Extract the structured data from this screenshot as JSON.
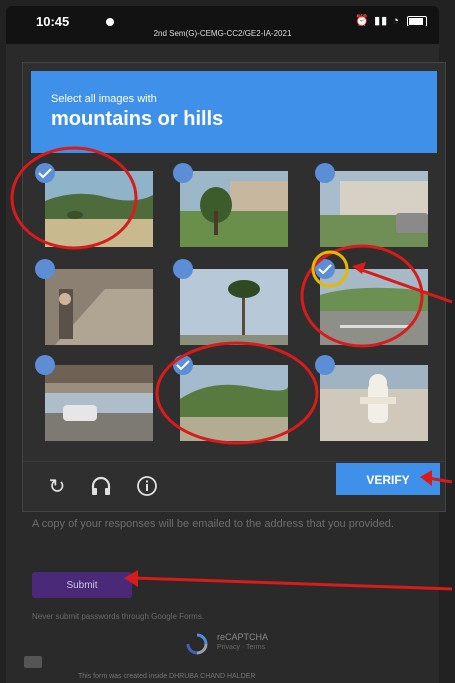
{
  "status_bar": {
    "time": "10:45",
    "battery_label": ""
  },
  "url_bar": {
    "text": "2nd Sem(G)-CEMG-CC2/GE2-IA-2021"
  },
  "captcha": {
    "instruction_line1": "Select all images with",
    "instruction_line2": "mountains or hills",
    "tiles": [
      {
        "id": "tile-1",
        "selected": true
      },
      {
        "id": "tile-2",
        "selected": false
      },
      {
        "id": "tile-3",
        "selected": false
      },
      {
        "id": "tile-4",
        "selected": false
      },
      {
        "id": "tile-5",
        "selected": false
      },
      {
        "id": "tile-6",
        "selected": true
      },
      {
        "id": "tile-7",
        "selected": false
      },
      {
        "id": "tile-8",
        "selected": true
      },
      {
        "id": "tile-9",
        "selected": false
      }
    ],
    "verify_label": "VERIFY",
    "icons": [
      "reload-icon",
      "headphones-icon",
      "info-icon"
    ]
  },
  "form": {
    "email_note": "A copy of your responses will be emailed to the address that you provided.",
    "submit_label": "Submit",
    "password_warning": "Never submit passwords through Google Forms.",
    "recaptcha_label": "reCAPTCHA",
    "recaptcha_links": "Privacy · Terms",
    "footer_text": "This form was created inside DHRUBA CHAND HALDER"
  },
  "colors": {
    "accent_blue": "#3f90e8",
    "annotation_red": "#d81b1b",
    "annotation_yellow": "#e6b800",
    "submit_purple": "#4a2a78"
  }
}
